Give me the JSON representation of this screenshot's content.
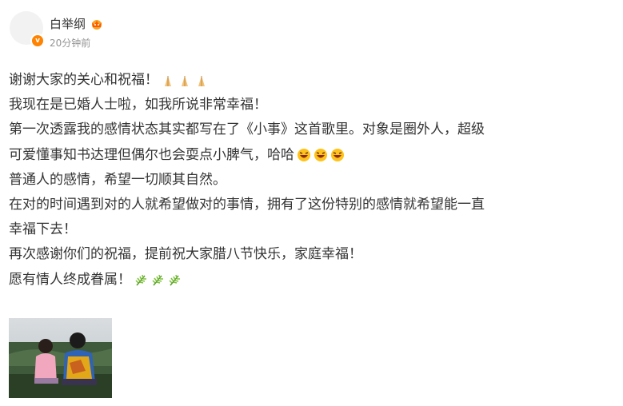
{
  "user": {
    "name": "白举纲",
    "time": "20分钟前",
    "verified_color": "#ff8200"
  },
  "post": {
    "lines": [
      "谢谢大家的关心和祝福！",
      "我现在是已婚人士啦，如我所说非常幸福！",
      "第一次透露我的感情状态其实都写在了《小事》这首歌里。对象是圈外人，超级",
      "可爱懂事知书达理但偶尔也会耍点小脾气，哈哈",
      "普通人的感情，希望一切顺其自然。",
      "在对的时间遇到对的人就希望做对的事情，拥有了这份特别的感情就希望能一直",
      "幸福下去！",
      "再次感谢你们的祝福，提前祝大家腊八节快乐，家庭幸福！",
      "愿有情人终成眷属！"
    ],
    "emoji": {
      "line0": "folded-hands-icon",
      "line3": "laughing-face-icon",
      "line8": "palm-leaf-icon"
    }
  },
  "media": {
    "image": "photo of two people sitting outdoors"
  }
}
